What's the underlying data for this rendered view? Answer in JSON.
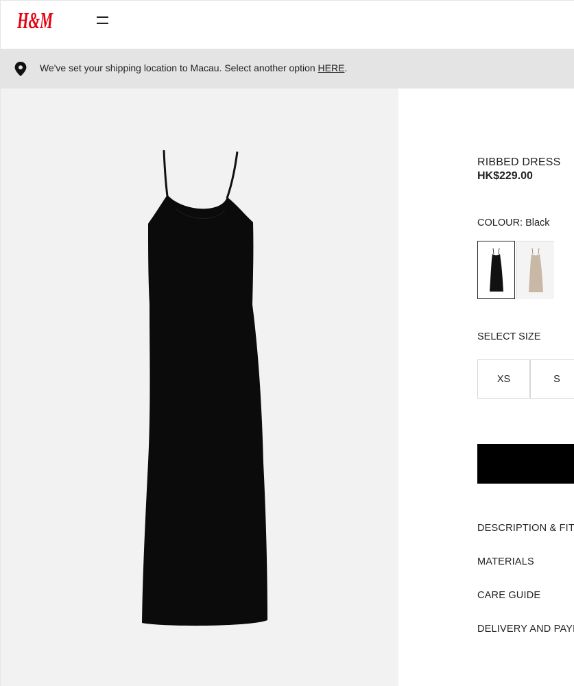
{
  "header": {
    "brand": "H&M",
    "brand_color": "#e50010",
    "menu_icon": "hamburger-menu-icon"
  },
  "banner": {
    "icon": "location-pin-icon",
    "text_prefix": "We've set your shipping location to Macau. Select another option ",
    "link_text": "HERE",
    "text_suffix": "."
  },
  "product": {
    "name": "RIBBED DRESS",
    "price": "HK$229.00",
    "colour_label": "COLOUR: Black",
    "colours": [
      {
        "name": "Black",
        "hex": "#111111",
        "selected": true
      },
      {
        "name": "Beige",
        "hex": "#c9b8a6",
        "selected": false
      }
    ],
    "size_label": "SELECT SIZE",
    "sizes": [
      "XS",
      "S"
    ],
    "add_button_color": "#000000"
  },
  "accordion": {
    "items": [
      "DESCRIPTION & FIT",
      "MATERIALS",
      "CARE GUIDE",
      "DELIVERY AND PAYMENT"
    ]
  }
}
